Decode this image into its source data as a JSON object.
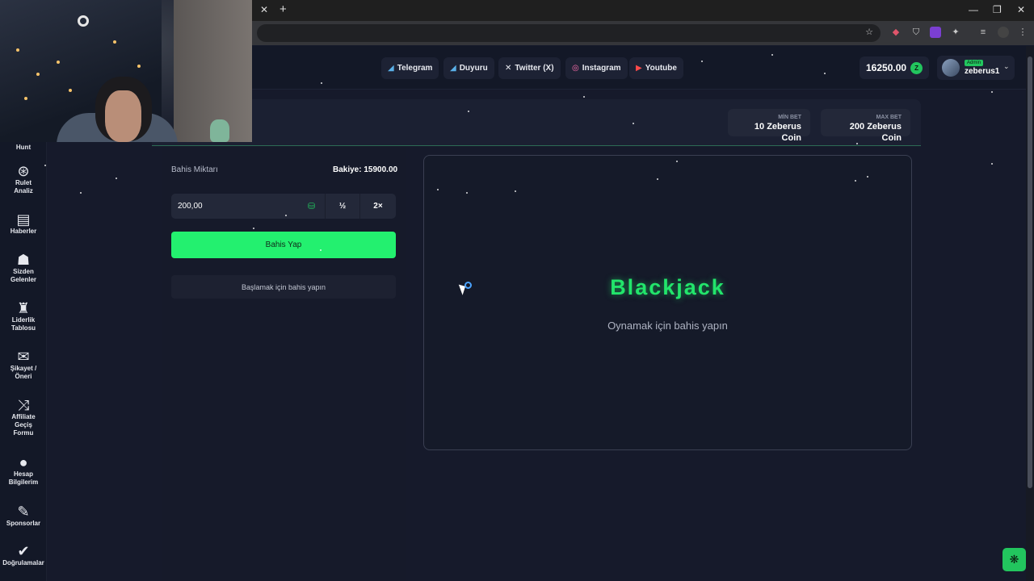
{
  "browser": {
    "close_tab_glyph": "✕",
    "new_tab_glyph": "+",
    "window_controls": [
      "—",
      "❐",
      "✕"
    ]
  },
  "social_links": [
    {
      "label": "Telegram",
      "icon": "telegram-icon",
      "glyph": "◢"
    },
    {
      "label": "Duyuru",
      "icon": "megaphone-icon",
      "glyph": "◢"
    },
    {
      "label": "Twitter (X)",
      "icon": "x-icon",
      "glyph": "✕"
    },
    {
      "label": "Instagram",
      "icon": "instagram-icon",
      "glyph": "◎"
    },
    {
      "label": "Youtube",
      "icon": "youtube-icon",
      "glyph": "▶"
    }
  ],
  "account": {
    "balance": "16250.00",
    "coin_glyph": "Z",
    "role_badge": "Admin",
    "username": "zeberus1",
    "chevron": "⌄"
  },
  "sidebar": {
    "items": [
      {
        "label": "Hunt",
        "glyph": ""
      },
      {
        "label": "Rulet Analiz",
        "glyph": "⊛"
      },
      {
        "label": "Haberler",
        "glyph": "▤"
      },
      {
        "label": "Sizden Gelenler",
        "glyph": "☗"
      },
      {
        "label": "Liderlik Tablosu",
        "glyph": "♜"
      },
      {
        "label": "Şikayet / Öneri",
        "glyph": "✉"
      },
      {
        "label": "Affiliate Geçiş Formu",
        "glyph": "⤨"
      },
      {
        "label": "Hesap Bilgilerim",
        "glyph": "●"
      },
      {
        "label": "Sponsorlar",
        "glyph": "✎"
      },
      {
        "label": "Doğrulamalar",
        "glyph": "✔"
      }
    ]
  },
  "bet_limits": {
    "min_label": "MİN BET",
    "min_value": "10 Zeberus Coin",
    "max_label": "MAX BET",
    "max_value": "200 Zeberus Coin"
  },
  "bet_panel": {
    "amount_label": "Bahis Miktarı",
    "balance_text": "Bakiye: 15900.00",
    "amount_value": "200,00",
    "coin_glyph": "⛁",
    "half_label": "½",
    "double_label": "2×",
    "bet_button": "Bahis Yap",
    "hint": "Başlamak için bahis yapın"
  },
  "game": {
    "title": "Blackjack",
    "subtitle": "Oynamak için bahis yapın"
  },
  "chat_widget": {
    "glyph": "❋"
  },
  "colors": {
    "accent_green": "#23f06f",
    "page_background": "#161a2b",
    "panel": "#232839"
  }
}
